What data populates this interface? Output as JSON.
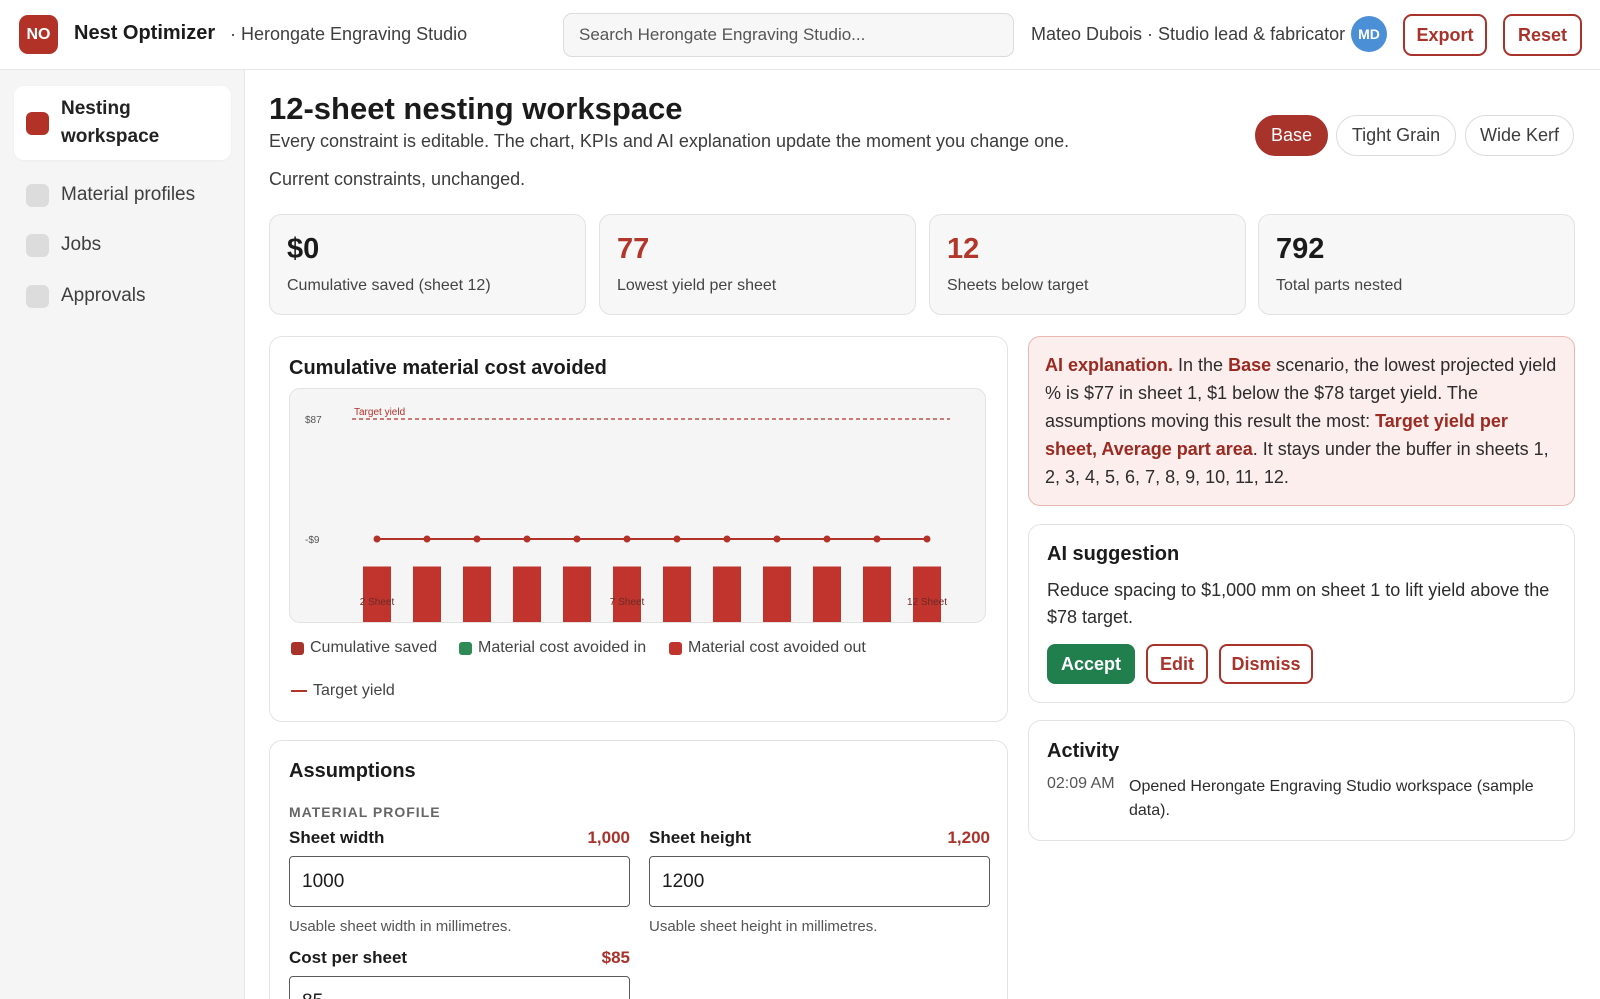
{
  "header": {
    "logo_initials": "NO",
    "app_name": "Nest Optimizer",
    "workspace": "· Herongate Engraving Studio",
    "search_placeholder": "Search Herongate Engraving Studio...",
    "user": "Mateo Dubois · Studio lead & fabricator",
    "avatar_initials": "MD",
    "export_label": "Export",
    "reset_label": "Reset"
  },
  "sidebar": {
    "items": [
      {
        "label": "Nesting workspace",
        "active": true
      },
      {
        "label": "Material profiles",
        "active": false
      },
      {
        "label": "Jobs",
        "active": false
      },
      {
        "label": "Approvals",
        "active": false
      }
    ]
  },
  "main": {
    "title": "12-sheet nesting workspace",
    "subtitle": "Every constraint is editable. The chart, KPIs and AI explanation update the moment you change one.",
    "status": "Current constraints, unchanged.",
    "scenarios": [
      "Base",
      "Tight Grain",
      "Wide Kerf"
    ],
    "active_scenario": "Base"
  },
  "kpis": [
    {
      "value": "$0",
      "label": "Cumulative saved (sheet 12)",
      "red": false
    },
    {
      "value": "77",
      "label": "Lowest yield per sheet",
      "red": true
    },
    {
      "value": "12",
      "label": "Sheets below target",
      "red": true
    },
    {
      "value": "792",
      "label": "Total parts nested",
      "red": false
    }
  ],
  "chart_card": {
    "title": "Cumulative material cost avoided",
    "legend": {
      "cumulative_saved": "Cumulative saved",
      "avoided_in": "Material cost avoided in",
      "avoided_out": "Material cost avoided out",
      "target_yield": "Target yield"
    }
  },
  "chart_data": {
    "type": "bar",
    "title": "Cumulative material cost avoided",
    "y_tick_labels": [
      "$87",
      "-$9"
    ],
    "target_line_label": "Target yield",
    "target_value": 87,
    "x_tick_labels": [
      "2 Sheet",
      "",
      "",
      "",
      "",
      "7 Sheet",
      "",
      "",
      "",
      "",
      "",
      "12 Sheet"
    ],
    "series": [
      {
        "name": "Cumulative saved",
        "type": "line",
        "values": [
          -9,
          -9,
          -9,
          -9,
          -9,
          -9,
          -9,
          -9,
          -9,
          -9,
          -9,
          -9
        ]
      },
      {
        "name": "Material cost avoided out",
        "type": "bar",
        "values": [
          -31,
          -31,
          -31,
          -31,
          -31,
          -31,
          -31,
          -31,
          -31,
          -31,
          -31,
          -31
        ]
      }
    ],
    "colors": {
      "line": "#b33228",
      "bar": "#c0342d",
      "target": "#b33228",
      "avoided_in": "#2f8a55"
    }
  },
  "ai_explanation": {
    "lead": "AI explanation.",
    "t1": " In the ",
    "scenario": "Base",
    "t2": " scenario, the lowest projected yield % is $77 in sheet 1, $1 below the $78 target yield. The assumptions moving this result the most: ",
    "k1": "Target yield per sheet",
    "sep": ", ",
    "k2": "Average part area",
    "t3": ". It stays under the buffer in sheets 1, 2, 3, 4, 5, 6, 7, 8, 9, 10, 11, 12."
  },
  "ai_suggestion": {
    "title": "AI suggestion",
    "text": "Reduce spacing to $1,000 mm on sheet 1 to lift yield above the $78 target.",
    "accept": "Accept",
    "edit": "Edit",
    "dismiss": "Dismiss"
  },
  "activity": {
    "title": "Activity",
    "entries": [
      {
        "time": "02:09 AM",
        "text": "Opened Herongate Engraving Studio workspace (sample data)."
      }
    ]
  },
  "assumptions": {
    "title": "Assumptions",
    "section": "MATERIAL PROFILE",
    "fields": [
      {
        "label": "Sheet width",
        "display": "1,000",
        "value": "1000",
        "help": "Usable sheet width in millimetres."
      },
      {
        "label": "Sheet height",
        "display": "1,200",
        "value": "1200",
        "help": "Usable sheet height in millimetres."
      },
      {
        "label": "Cost per sheet",
        "display": "$85",
        "value": "85",
        "help": ""
      }
    ]
  }
}
